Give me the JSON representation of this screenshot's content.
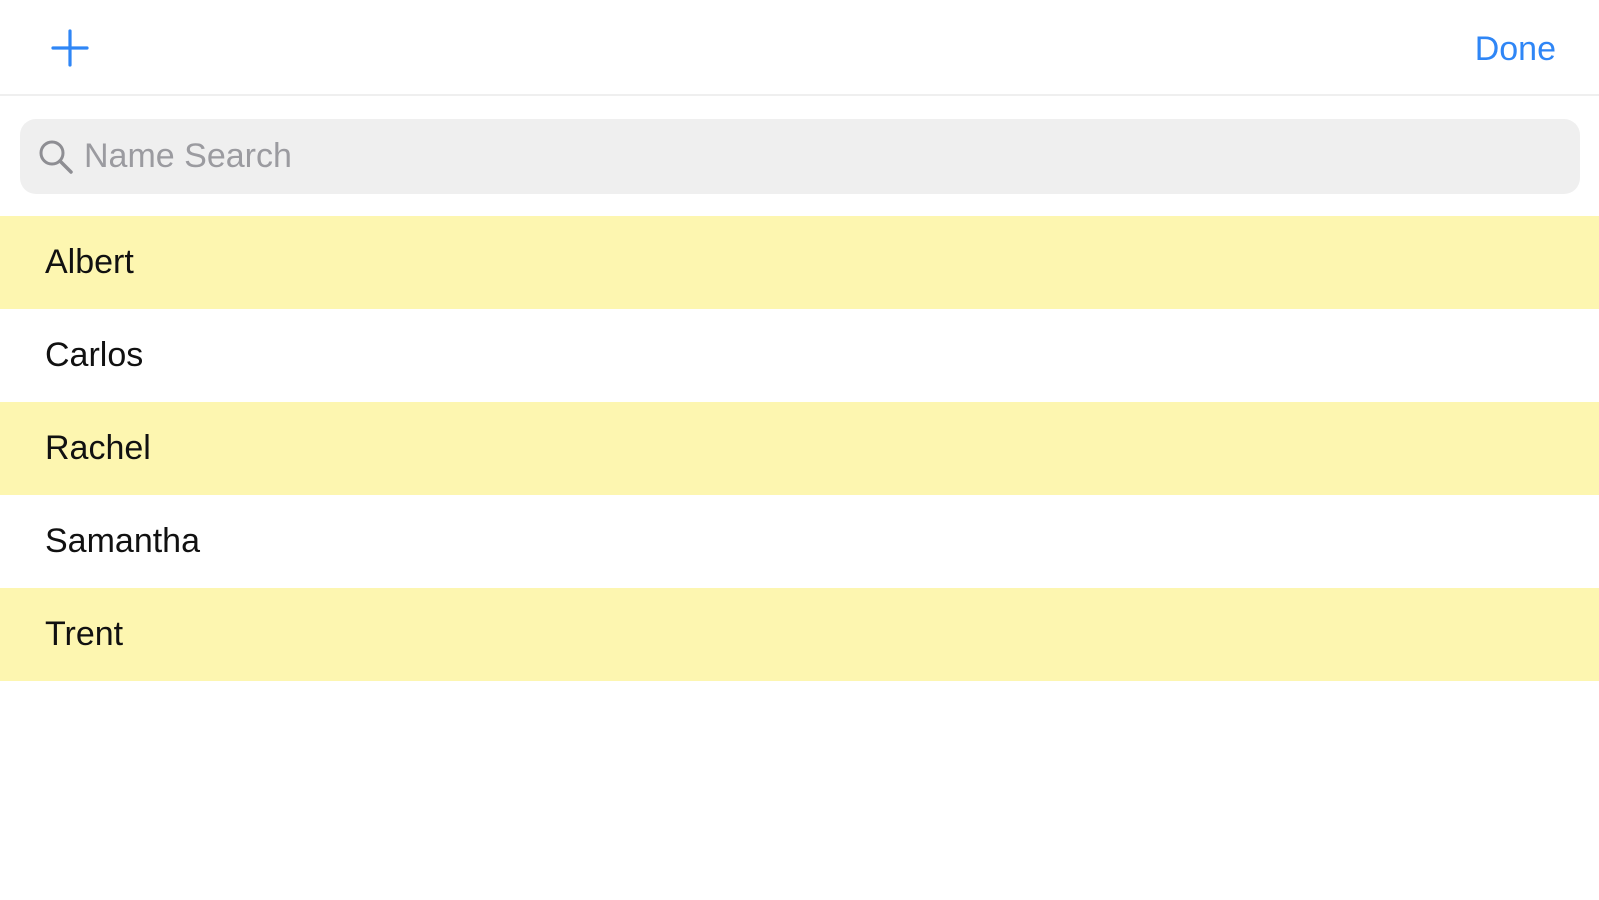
{
  "colors": {
    "accent": "#2f86f6",
    "highlight": "#fdf6b0"
  },
  "nav": {
    "add_icon": "plus-icon",
    "done_label": "Done"
  },
  "search": {
    "placeholder": "Name Search",
    "value": "",
    "icon": "search-icon"
  },
  "names": [
    {
      "label": "Albert",
      "highlighted": true
    },
    {
      "label": "Carlos",
      "highlighted": false
    },
    {
      "label": "Rachel",
      "highlighted": true
    },
    {
      "label": "Samantha",
      "highlighted": false
    },
    {
      "label": "Trent",
      "highlighted": true
    }
  ]
}
